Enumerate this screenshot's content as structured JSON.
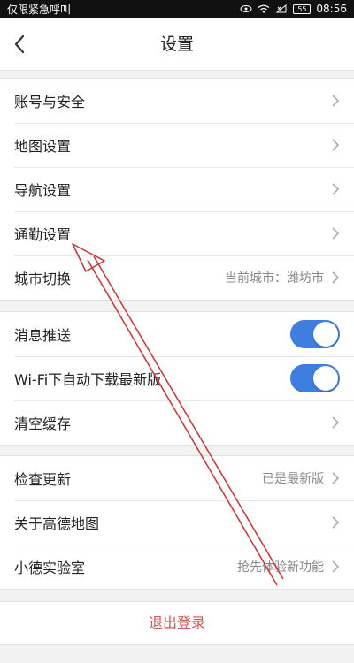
{
  "status_bar": {
    "left_text": "仅限紧急呼叫",
    "battery": "55",
    "time": "08:56"
  },
  "nav": {
    "title": "设置"
  },
  "groups": [
    {
      "items": [
        {
          "label": "账号与安全"
        },
        {
          "label": "地图设置"
        },
        {
          "label": "导航设置"
        },
        {
          "label": "通勤设置"
        },
        {
          "label": "城市切换",
          "value": "当前城市：潍坊市"
        }
      ]
    },
    {
      "items": [
        {
          "label": "消息推送",
          "toggle": true
        },
        {
          "label": "Wi-Fi下自动下载最新版",
          "toggle": true
        },
        {
          "label": "清空缓存"
        }
      ]
    },
    {
      "items": [
        {
          "label": "检查更新",
          "value": "已是最新版"
        },
        {
          "label": "关于高德地图"
        },
        {
          "label": "小德实验室",
          "value": "抢先体验新功能"
        }
      ]
    }
  ],
  "logout": {
    "label": "退出登录"
  },
  "colors": {
    "toggle_on": "#3d7ee0",
    "logout_text": "#d9534f",
    "annotation_arrow": "#d32f2f"
  },
  "icons": {
    "back": "chevron-left-icon",
    "row_arrow": "chevron-right-icon",
    "wifi": "wifi-icon",
    "battery": "battery-icon"
  }
}
